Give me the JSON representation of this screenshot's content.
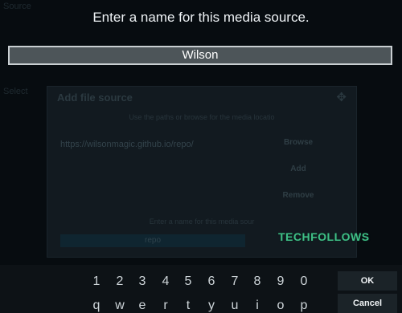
{
  "background": {
    "top_label": "Source",
    "side_label": "Select",
    "dialog_title": "Add file source",
    "path_hint": "Use the paths or browse for the media locatio",
    "path_value": "https://wilsonmagic.github.io/repo/",
    "browse_label": "Browse",
    "add_label": "Add",
    "remove_label": "Remove",
    "name_hint": "Enter a name for this media sour",
    "name_value": "repo"
  },
  "watermark": "TECHFOLLOWS",
  "prompt": {
    "title": "Enter a name for this media source.",
    "value": "Wilson"
  },
  "keyboard": {
    "row1": [
      "1",
      "2",
      "3",
      "4",
      "5",
      "6",
      "7",
      "8",
      "9",
      "0"
    ],
    "row2": [
      "q",
      "w",
      "e",
      "r",
      "t",
      "y",
      "u",
      "i",
      "o",
      "p"
    ],
    "ok_label": "OK",
    "cancel_label": "Cancel"
  }
}
